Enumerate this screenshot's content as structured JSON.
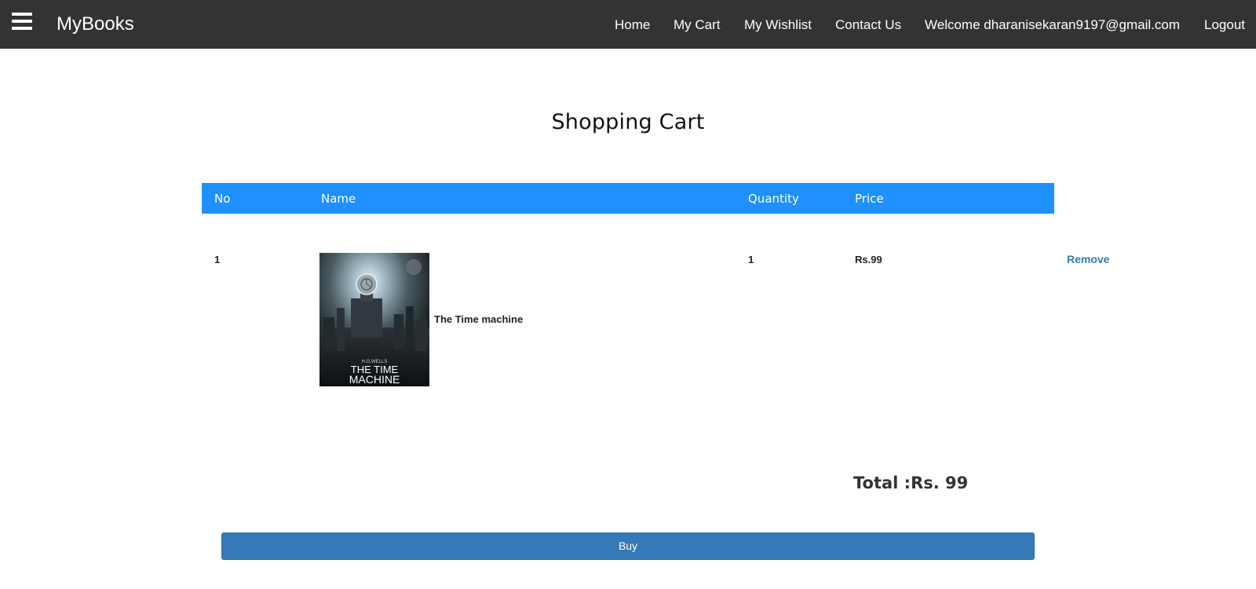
{
  "navbar": {
    "brand": "MyBooks",
    "menu_icon": "hamburger-menu-icon",
    "links": {
      "home": "Home",
      "cart": "My Cart",
      "wishlist": "My Wishlist",
      "contact": "Contact Us",
      "welcome": "Welcome dharanisekaran9197@gmail.com",
      "logout": "Logout"
    },
    "bg_color": "#333333"
  },
  "page": {
    "title": "Shopping Cart"
  },
  "table": {
    "header_color": "#1e90ff",
    "headers": {
      "no": "No",
      "name": "Name",
      "quantity": "Quantity",
      "price": "Price"
    },
    "rows": [
      {
        "no": "1",
        "name": "The Time machine",
        "quantity": "1",
        "price": "Rs.99",
        "action": "Remove",
        "cover": {
          "author": "H.G.WELLS",
          "title_line1": "THE TIME",
          "title_line2": "MACHINE"
        }
      }
    ]
  },
  "summary": {
    "total_label": "Total :",
    "total_value": "Rs. 99"
  },
  "actions": {
    "buy_label": "Buy",
    "button_color": "#337ab7"
  }
}
